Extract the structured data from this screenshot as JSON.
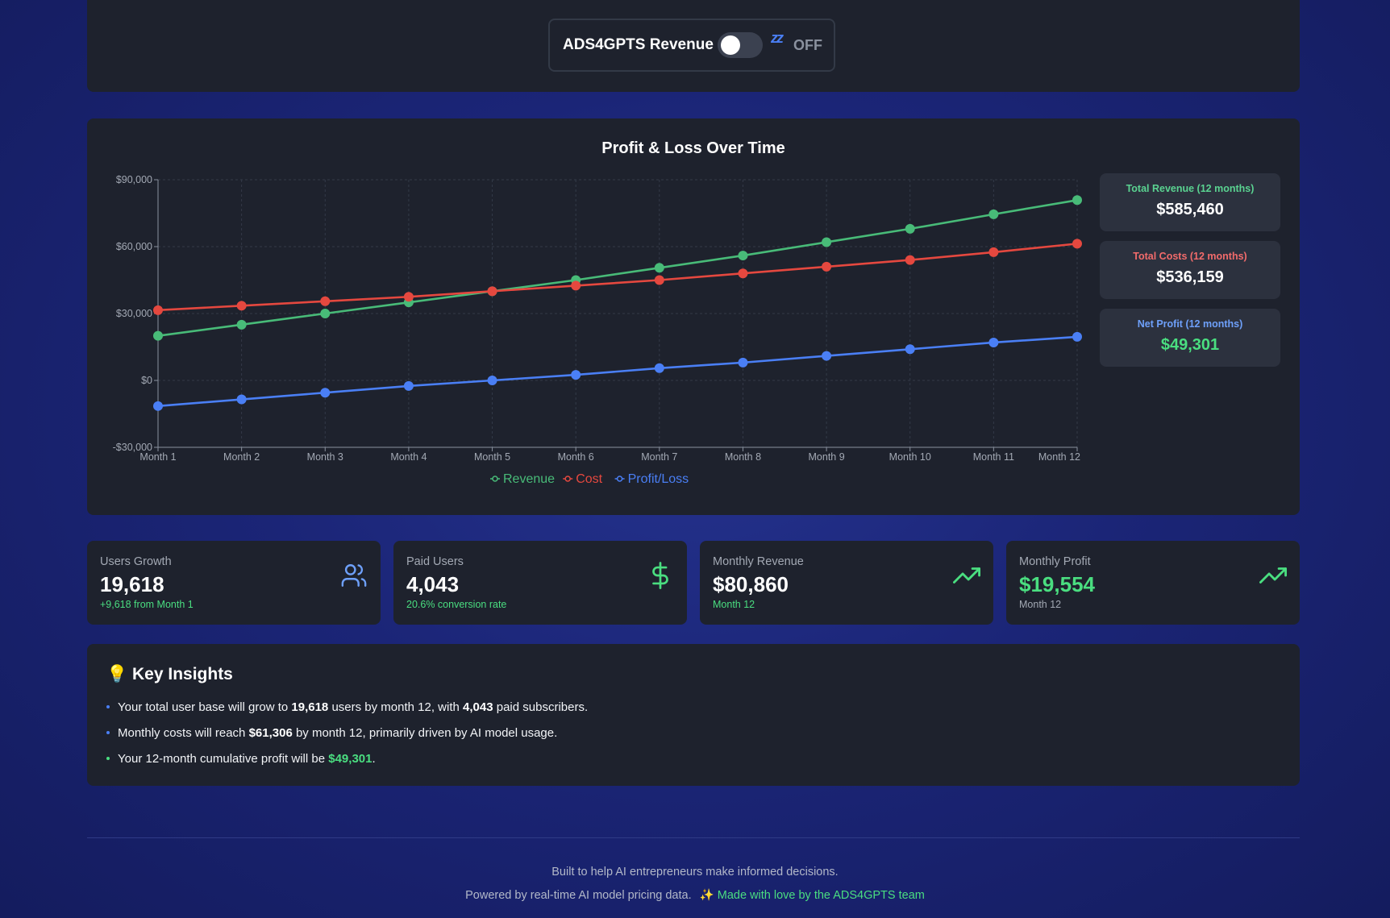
{
  "toggle": {
    "title": "ADS4GPTS Revenue",
    "state_icon": "zz",
    "state_label": "OFF",
    "enabled": false
  },
  "chart_title": "Profit & Loss Over Time",
  "chart_data": {
    "type": "line",
    "title": "Profit & Loss Over Time",
    "categories": [
      "Month 1",
      "Month 2",
      "Month 3",
      "Month 4",
      "Month 5",
      "Month 6",
      "Month 7",
      "Month 8",
      "Month 9",
      "Month 10",
      "Month 11",
      "Month 12"
    ],
    "ylim": [
      -30000,
      90000
    ],
    "yticks": [
      -30000,
      0,
      30000,
      60000,
      90000
    ],
    "ytick_labels": [
      "-$30,000",
      "$0",
      "$30,000",
      "$60,000",
      "$90,000"
    ],
    "grid": true,
    "legend_position": "bottom",
    "series": [
      {
        "name": "Revenue",
        "color": "#48bb78",
        "values": [
          20000,
          25000,
          30000,
          35000,
          40000,
          45000,
          50500,
          56000,
          62000,
          68000,
          74500,
          80860
        ]
      },
      {
        "name": "Cost",
        "color": "#e5483f",
        "values": [
          31500,
          33500,
          35500,
          37500,
          40000,
          42500,
          45000,
          48000,
          51000,
          54000,
          57500,
          61306
        ]
      },
      {
        "name": "Profit/Loss",
        "color": "#4a7ff5",
        "values": [
          -11500,
          -8500,
          -5500,
          -2500,
          0,
          2500,
          5500,
          8000,
          11000,
          14000,
          17000,
          19554
        ]
      }
    ]
  },
  "summary": [
    {
      "label": "Total Revenue (12 months)",
      "value": "$585,460",
      "label_color": "#5ad391",
      "value_color": "#ffffff"
    },
    {
      "label": "Total Costs (12 months)",
      "value": "$536,159",
      "label_color": "#f26b6b",
      "value_color": "#ffffff"
    },
    {
      "label": "Net Profit (12 months)",
      "value": "$49,301",
      "label_color": "#6ea0fa",
      "value_color": "#4ade80"
    }
  ],
  "cards": [
    {
      "label": "Users Growth",
      "value": "19,618",
      "sub": "+9,618 from Month 1",
      "icon": "users-icon",
      "value_color": "#ffffff",
      "sub_color": "#4ade80",
      "icon_color": "#6ea0fa"
    },
    {
      "label": "Paid Users",
      "value": "4,043",
      "sub": "20.6% conversion rate",
      "icon": "dollar-icon",
      "value_color": "#ffffff",
      "sub_color": "#4ade80",
      "icon_color": "#4ade80"
    },
    {
      "label": "Monthly Revenue",
      "value": "$80,860",
      "sub": "Month 12",
      "icon": "trending-up-icon",
      "value_color": "#ffffff",
      "sub_color": "#4ade80",
      "icon_color": "#4ade80"
    },
    {
      "label": "Monthly Profit",
      "value": "$19,554",
      "sub": "Month 12",
      "icon": "trending-up-icon",
      "value_color": "#4ade80",
      "sub_color": "#a3a9b4",
      "icon_color": "#4ade80"
    }
  ],
  "insights": {
    "icon": "💡",
    "title": "Key Insights",
    "items": [
      {
        "parts": [
          "Your total user base will grow to ",
          "19,618",
          " users by month 12, with ",
          "4,043",
          " paid subscribers."
        ],
        "bullet_color": "#4a7ff5"
      },
      {
        "parts": [
          "Monthly costs will reach ",
          "$61,306",
          " by month 12, primarily driven by AI model usage."
        ],
        "bullet_color": "#4a7ff5"
      },
      {
        "parts": [
          "Your 12-month cumulative profit will be ",
          "$49,301",
          "."
        ],
        "bullet_color": "#4ade80"
      }
    ]
  },
  "footer": {
    "line1": "Built to help AI entrepreneurs make informed decisions.",
    "line2": "Powered by real-time AI model pricing data.",
    "sparkle": "✨",
    "love": "Made with love by the ADS4GPTS team"
  }
}
